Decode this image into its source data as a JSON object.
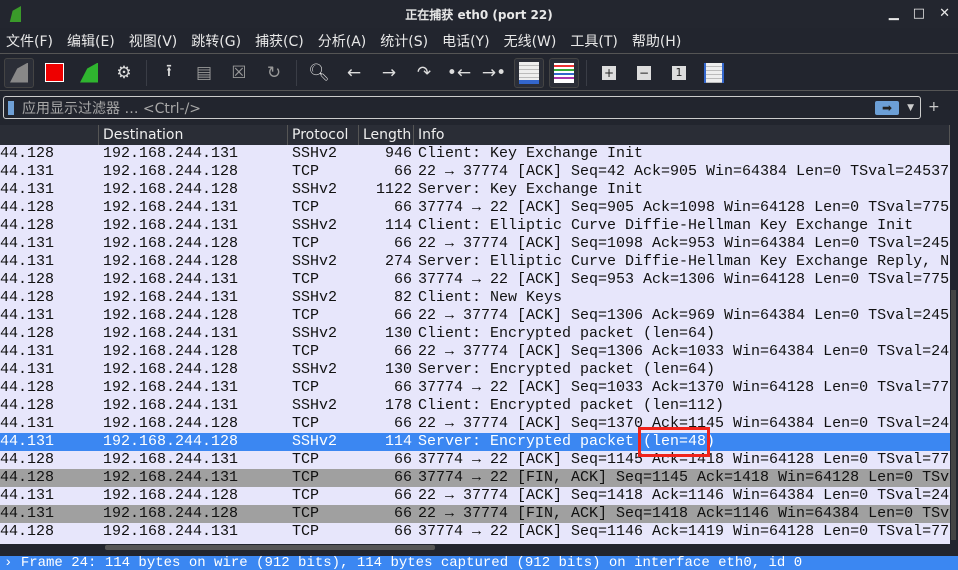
{
  "window": {
    "title": "正在捕获 eth0 (port 22)",
    "minimize": "▁",
    "maximize": "□",
    "close": "✕"
  },
  "menu": [
    "文件(F)",
    "编辑(E)",
    "视图(V)",
    "跳转(G)",
    "捕获(C)",
    "分析(A)",
    "统计(S)",
    "电话(Y)",
    "无线(W)",
    "工具(T)",
    "帮助(H)"
  ],
  "filter": {
    "placeholder": "应用显示过滤器 … <Ctrl-/>",
    "apply": "➡",
    "plus": "+"
  },
  "columns": [
    "",
    "Destination",
    "Protocol",
    "Length",
    "Info"
  ],
  "rows": [
    {
      "src": "44.128",
      "dst": "192.168.244.131",
      "proto": "SSHv2",
      "len": "946",
      "info": "Client: Key Exchange Init"
    },
    {
      "src": "44.131",
      "dst": "192.168.244.128",
      "proto": "TCP",
      "len": "66",
      "info": "22 → 37774 [ACK] Seq=42 Ack=905 Win=64384 Len=0 TSval=24537"
    },
    {
      "src": "44.131",
      "dst": "192.168.244.128",
      "proto": "SSHv2",
      "len": "1122",
      "info": "Server: Key Exchange Init"
    },
    {
      "src": "44.128",
      "dst": "192.168.244.131",
      "proto": "TCP",
      "len": "66",
      "info": "37774 → 22 [ACK] Seq=905 Ack=1098 Win=64128 Len=0 TSval=775"
    },
    {
      "src": "44.128",
      "dst": "192.168.244.131",
      "proto": "SSHv2",
      "len": "114",
      "info": "Client: Elliptic Curve Diffie-Hellman Key Exchange Init"
    },
    {
      "src": "44.131",
      "dst": "192.168.244.128",
      "proto": "TCP",
      "len": "66",
      "info": "22 → 37774 [ACK] Seq=1098 Ack=953 Win=64384 Len=0 TSval=245"
    },
    {
      "src": "44.131",
      "dst": "192.168.244.128",
      "proto": "SSHv2",
      "len": "274",
      "info": "Server: Elliptic Curve Diffie-Hellman Key Exchange Reply, N"
    },
    {
      "src": "44.128",
      "dst": "192.168.244.131",
      "proto": "TCP",
      "len": "66",
      "info": "37774 → 22 [ACK] Seq=953 Ack=1306 Win=64128 Len=0 TSval=775"
    },
    {
      "src": "44.128",
      "dst": "192.168.244.131",
      "proto": "SSHv2",
      "len": "82",
      "info": "Client: New Keys"
    },
    {
      "src": "44.131",
      "dst": "192.168.244.128",
      "proto": "TCP",
      "len": "66",
      "info": "22 → 37774 [ACK] Seq=1306 Ack=969 Win=64384 Len=0 TSval=245"
    },
    {
      "src": "44.128",
      "dst": "192.168.244.131",
      "proto": "SSHv2",
      "len": "130",
      "info": "Client: Encrypted packet (len=64)"
    },
    {
      "src": "44.131",
      "dst": "192.168.244.128",
      "proto": "TCP",
      "len": "66",
      "info": "22 → 37774 [ACK] Seq=1306 Ack=1033 Win=64384 Len=0 TSval=24"
    },
    {
      "src": "44.131",
      "dst": "192.168.244.128",
      "proto": "SSHv2",
      "len": "130",
      "info": "Server: Encrypted packet (len=64)"
    },
    {
      "src": "44.128",
      "dst": "192.168.244.131",
      "proto": "TCP",
      "len": "66",
      "info": "37774 → 22 [ACK] Seq=1033 Ack=1370 Win=64128 Len=0 TSval=77"
    },
    {
      "src": "44.128",
      "dst": "192.168.244.131",
      "proto": "SSHv2",
      "len": "178",
      "info": "Client: Encrypted packet (len=112)"
    },
    {
      "src": "44.131",
      "dst": "192.168.244.128",
      "proto": "TCP",
      "len": "66",
      "info": "22 → 37774 [ACK] Seq=1370 Ack=1145 Win=64384 Len=0 TSval=24"
    },
    {
      "src": "44.131",
      "dst": "192.168.244.128",
      "proto": "SSHv2",
      "len": "114",
      "info": "Server: Encrypted packet (len=48)",
      "style": "sel"
    },
    {
      "src": "44.128",
      "dst": "192.168.244.131",
      "proto": "TCP",
      "len": "66",
      "info": "37774 → 22 [ACK] Seq=1145 Ack=1418 Win=64128 Len=0 TSval=77"
    },
    {
      "src": "44.128",
      "dst": "192.168.244.131",
      "proto": "TCP",
      "len": "66",
      "info": "37774 → 22 [FIN, ACK] Seq=1145 Ack=1418 Win=64128 Len=0 TSv",
      "style": "gray"
    },
    {
      "src": "44.131",
      "dst": "192.168.244.128",
      "proto": "TCP",
      "len": "66",
      "info": "22 → 37774 [ACK] Seq=1418 Ack=1146 Win=64384 Len=0 TSval=24"
    },
    {
      "src": "44.131",
      "dst": "192.168.244.128",
      "proto": "TCP",
      "len": "66",
      "info": "22 → 37774 [FIN, ACK] Seq=1418 Ack=1146 Win=64384 Len=0 TSv",
      "style": "gray"
    },
    {
      "src": "44.128",
      "dst": "192.168.244.131",
      "proto": "TCP",
      "len": "66",
      "info": "37774 → 22 [ACK] Seq=1146 Ack=1419 Win=64128 Len=0 TSval=77"
    }
  ],
  "status": {
    "arrow": "›",
    "text": "Frame 24: 114 bytes on wire (912 bits), 114 bytes captured (912 bits) on interface eth0, id 0"
  },
  "colors": {
    "row": "#e7e6fb",
    "selected": "#3b87f2",
    "gray": "#a0a0a0",
    "highlight": "#f0241c"
  }
}
